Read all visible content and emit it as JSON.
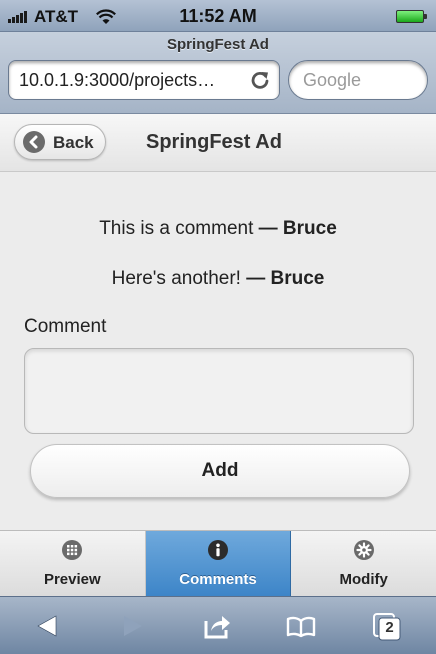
{
  "status": {
    "carrier": "AT&T",
    "time": "11:52 AM"
  },
  "browser": {
    "title": "SpringFest Ad",
    "url": "10.0.1.9:3000/projects…",
    "search_placeholder": "Google"
  },
  "header": {
    "back_label": "Back",
    "title": "SpringFest Ad"
  },
  "comments": [
    {
      "text": "This is a comment",
      "separator": "—",
      "author": "Bruce"
    },
    {
      "text": "Here's another!",
      "separator": "—",
      "author": "Bruce"
    }
  ],
  "form": {
    "label": "Comment",
    "value": "",
    "submit_label": "Add"
  },
  "tabs": [
    {
      "label": "Preview",
      "icon": "grid-icon",
      "active": false
    },
    {
      "label": "Comments",
      "icon": "info-icon",
      "active": true
    },
    {
      "label": "Modify",
      "icon": "gear-icon",
      "active": false
    }
  ],
  "toolbar": {
    "tab_count": "2",
    "icons": [
      "back-arrow-icon",
      "forward-arrow-icon",
      "share-icon",
      "bookmarks-icon",
      "pages-icon"
    ]
  },
  "colors": {
    "active_tab": "#4a8fd0",
    "chrome": "#8fa3bb",
    "battery": "#2cc52c"
  }
}
